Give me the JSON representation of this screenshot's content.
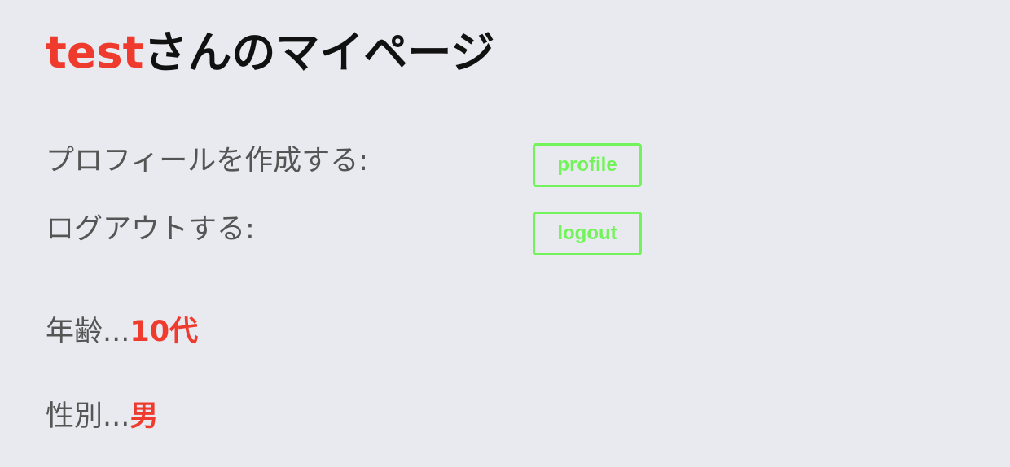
{
  "header": {
    "username": "test",
    "title_suffix": "さんのマイページ"
  },
  "actions": {
    "profile_label": "プロフィールを作成する:",
    "profile_button": "profile",
    "logout_label": "ログアウトする:",
    "logout_button": "logout"
  },
  "info": {
    "age_label": "年齢...",
    "age_value": "10代",
    "gender_label": "性別...",
    "gender_value": "男"
  },
  "colors": {
    "background": "#e9eaf0",
    "accent_red": "#ef3a2e",
    "button_green": "#72f35a",
    "label_gray": "#555555"
  }
}
